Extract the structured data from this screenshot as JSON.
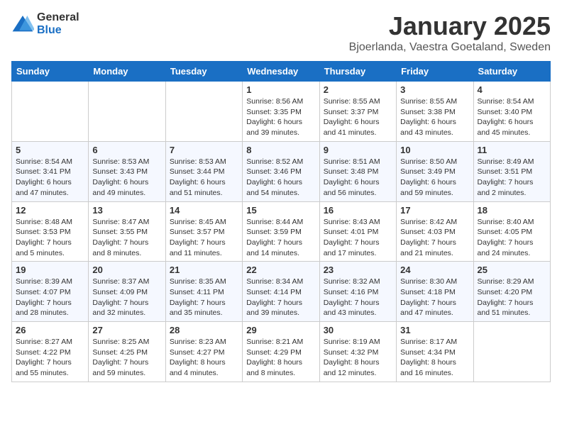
{
  "header": {
    "logo": {
      "general": "General",
      "blue": "Blue"
    },
    "title": "January 2025",
    "location": "Bjoerlanda, Vaestra Goetaland, Sweden"
  },
  "weekdays": [
    "Sunday",
    "Monday",
    "Tuesday",
    "Wednesday",
    "Thursday",
    "Friday",
    "Saturday"
  ],
  "weeks": [
    [
      {
        "day": "",
        "info": ""
      },
      {
        "day": "",
        "info": ""
      },
      {
        "day": "",
        "info": ""
      },
      {
        "day": "1",
        "info": "Sunrise: 8:56 AM\nSunset: 3:35 PM\nDaylight: 6 hours and 39 minutes."
      },
      {
        "day": "2",
        "info": "Sunrise: 8:55 AM\nSunset: 3:37 PM\nDaylight: 6 hours and 41 minutes."
      },
      {
        "day": "3",
        "info": "Sunrise: 8:55 AM\nSunset: 3:38 PM\nDaylight: 6 hours and 43 minutes."
      },
      {
        "day": "4",
        "info": "Sunrise: 8:54 AM\nSunset: 3:40 PM\nDaylight: 6 hours and 45 minutes."
      }
    ],
    [
      {
        "day": "5",
        "info": "Sunrise: 8:54 AM\nSunset: 3:41 PM\nDaylight: 6 hours and 47 minutes."
      },
      {
        "day": "6",
        "info": "Sunrise: 8:53 AM\nSunset: 3:43 PM\nDaylight: 6 hours and 49 minutes."
      },
      {
        "day": "7",
        "info": "Sunrise: 8:53 AM\nSunset: 3:44 PM\nDaylight: 6 hours and 51 minutes."
      },
      {
        "day": "8",
        "info": "Sunrise: 8:52 AM\nSunset: 3:46 PM\nDaylight: 6 hours and 54 minutes."
      },
      {
        "day": "9",
        "info": "Sunrise: 8:51 AM\nSunset: 3:48 PM\nDaylight: 6 hours and 56 minutes."
      },
      {
        "day": "10",
        "info": "Sunrise: 8:50 AM\nSunset: 3:49 PM\nDaylight: 6 hours and 59 minutes."
      },
      {
        "day": "11",
        "info": "Sunrise: 8:49 AM\nSunset: 3:51 PM\nDaylight: 7 hours and 2 minutes."
      }
    ],
    [
      {
        "day": "12",
        "info": "Sunrise: 8:48 AM\nSunset: 3:53 PM\nDaylight: 7 hours and 5 minutes."
      },
      {
        "day": "13",
        "info": "Sunrise: 8:47 AM\nSunset: 3:55 PM\nDaylight: 7 hours and 8 minutes."
      },
      {
        "day": "14",
        "info": "Sunrise: 8:45 AM\nSunset: 3:57 PM\nDaylight: 7 hours and 11 minutes."
      },
      {
        "day": "15",
        "info": "Sunrise: 8:44 AM\nSunset: 3:59 PM\nDaylight: 7 hours and 14 minutes."
      },
      {
        "day": "16",
        "info": "Sunrise: 8:43 AM\nSunset: 4:01 PM\nDaylight: 7 hours and 17 minutes."
      },
      {
        "day": "17",
        "info": "Sunrise: 8:42 AM\nSunset: 4:03 PM\nDaylight: 7 hours and 21 minutes."
      },
      {
        "day": "18",
        "info": "Sunrise: 8:40 AM\nSunset: 4:05 PM\nDaylight: 7 hours and 24 minutes."
      }
    ],
    [
      {
        "day": "19",
        "info": "Sunrise: 8:39 AM\nSunset: 4:07 PM\nDaylight: 7 hours and 28 minutes."
      },
      {
        "day": "20",
        "info": "Sunrise: 8:37 AM\nSunset: 4:09 PM\nDaylight: 7 hours and 32 minutes."
      },
      {
        "day": "21",
        "info": "Sunrise: 8:35 AM\nSunset: 4:11 PM\nDaylight: 7 hours and 35 minutes."
      },
      {
        "day": "22",
        "info": "Sunrise: 8:34 AM\nSunset: 4:14 PM\nDaylight: 7 hours and 39 minutes."
      },
      {
        "day": "23",
        "info": "Sunrise: 8:32 AM\nSunset: 4:16 PM\nDaylight: 7 hours and 43 minutes."
      },
      {
        "day": "24",
        "info": "Sunrise: 8:30 AM\nSunset: 4:18 PM\nDaylight: 7 hours and 47 minutes."
      },
      {
        "day": "25",
        "info": "Sunrise: 8:29 AM\nSunset: 4:20 PM\nDaylight: 7 hours and 51 minutes."
      }
    ],
    [
      {
        "day": "26",
        "info": "Sunrise: 8:27 AM\nSunset: 4:22 PM\nDaylight: 7 hours and 55 minutes."
      },
      {
        "day": "27",
        "info": "Sunrise: 8:25 AM\nSunset: 4:25 PM\nDaylight: 7 hours and 59 minutes."
      },
      {
        "day": "28",
        "info": "Sunrise: 8:23 AM\nSunset: 4:27 PM\nDaylight: 8 hours and 4 minutes."
      },
      {
        "day": "29",
        "info": "Sunrise: 8:21 AM\nSunset: 4:29 PM\nDaylight: 8 hours and 8 minutes."
      },
      {
        "day": "30",
        "info": "Sunrise: 8:19 AM\nSunset: 4:32 PM\nDaylight: 8 hours and 12 minutes."
      },
      {
        "day": "31",
        "info": "Sunrise: 8:17 AM\nSunset: 4:34 PM\nDaylight: 8 hours and 16 minutes."
      },
      {
        "day": "",
        "info": ""
      }
    ]
  ]
}
